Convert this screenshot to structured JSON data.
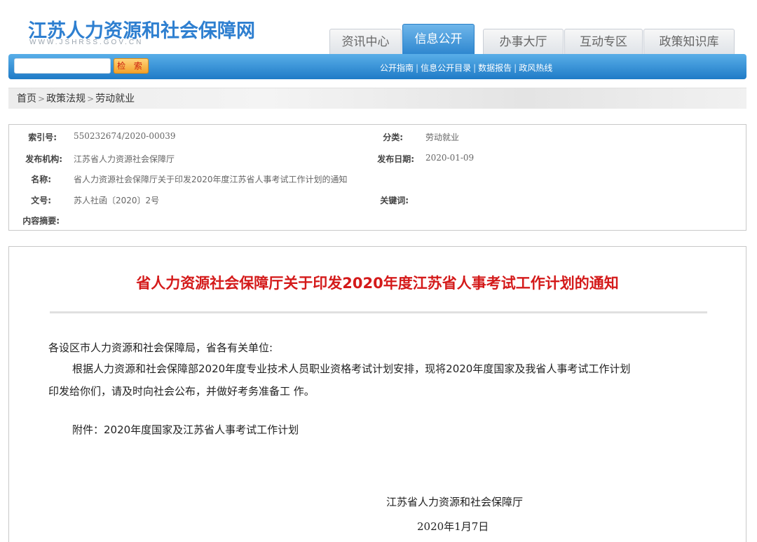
{
  "header": {
    "logo_title": "江苏人力资源和社会保障网",
    "logo_url": "WWW.JSHRSS.GOV.CN"
  },
  "tabs": [
    {
      "label": "资讯中心",
      "active": false
    },
    {
      "label": "信息公开",
      "active": true
    },
    {
      "label": "办事大厅",
      "active": false
    },
    {
      "label": "互动专区",
      "active": false
    },
    {
      "label": "政策知识库",
      "active": false
    }
  ],
  "search": {
    "value": "",
    "button_label": "检 索"
  },
  "sublinks": [
    "公开指南",
    "信息公开目录",
    "数据报告",
    "政风热线"
  ],
  "breadcrumb": [
    "首页",
    "政策法规",
    "劳动就业"
  ],
  "meta": {
    "index_label": "索引号:",
    "index_value": "550232674/2020-00039",
    "category_label": "分类:",
    "category_value": "劳动就业",
    "publisher_label": "发布机构:",
    "publisher_value": "江苏省人力资源社会保障厅",
    "date_label": "发布日期:",
    "date_value": "2020-01-09",
    "name_label": "名称:",
    "name_value": "省人力资源社会保障厅关于印发2020年度江苏省人事考试工作计划的通知",
    "docno_label": "文号:",
    "docno_value": "苏人社函〔2020〕2号",
    "keywords_label": "关键词:",
    "keywords_value": "",
    "summary_label": "内容摘要:",
    "summary_value": ""
  },
  "document": {
    "title": "省人力资源社会保障厅关于印发2020年度江苏省人事考试工作计划的通知",
    "salutation": "各设区市人力资源和社会保障局，省各有关单位:",
    "body_line1": "根据人力资源和社会保障部2020年度专业技术人员职业资格考试计划安排，现将2020年度国家及我省人事考试工作计划",
    "body_line2": "印发给你们，请及时向社会公布，并做好考务准备工 作。",
    "attachment": "附件：2020年度国家及江苏省人事考试工作计划",
    "signature": "江苏省人力资源和社会保障厅",
    "sign_date": "2020年1月7日"
  },
  "colors": {
    "accent_blue": "#2d86cf",
    "title_red": "#d41a1a",
    "search_button": "#f2a12b"
  }
}
